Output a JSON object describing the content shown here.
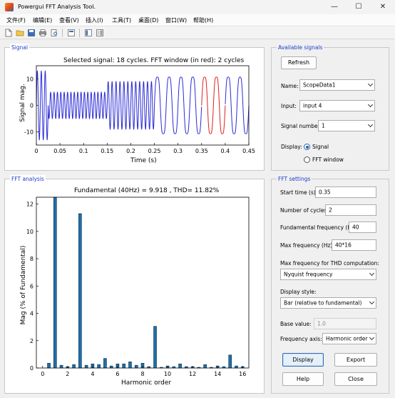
{
  "window": {
    "title": "Powergui FFT Analysis Tool."
  },
  "menu": [
    "文件(F)",
    "编辑(E)",
    "查看(V)",
    "插入(I)",
    "工具(T)",
    "桌面(D)",
    "窗口(W)",
    "帮助(H)"
  ],
  "toolbar_icons": [
    "new-file-icon",
    "open-folder-icon",
    "save-icon",
    "print-icon",
    "print-preview-icon",
    "dock-figure-icon",
    "show-plot-tools-icon",
    "hide-plot-tools-icon"
  ],
  "signal_panel": {
    "title": "Signal",
    "plot_title": "Selected signal: 18 cycles. FFT window (in red): 2 cycles",
    "ylabel": "Signal mag.",
    "xlabel": "Time (s)"
  },
  "available_signals": {
    "title": "Available signals",
    "refresh_label": "Refresh",
    "name_label": "Name:",
    "name_value": "ScopeData1",
    "input_label": "Input:",
    "input_value": "input 4",
    "signal_number_label": "Signal number:",
    "signal_number_value": "1",
    "display_label": "Display:",
    "display_options": [
      "Signal",
      "FFT window"
    ],
    "display_selected": "Signal"
  },
  "fft_panel": {
    "title": "FFT analysis",
    "plot_title": "Fundamental (40Hz) = 9.918 , THD= 11.82%",
    "ylabel": "Mag (% of Fundamental)",
    "xlabel": "Harmonic order"
  },
  "fft_settings": {
    "title": "FFT settings",
    "start_time_label": "Start time (s):",
    "start_time_value": "0.35",
    "num_cycles_label": "Number of cycles:",
    "num_cycles_value": "2",
    "fund_freq_label": "Fundamental frequency (Hz):",
    "fund_freq_value": "40",
    "max_freq_label": "Max frequency (Hz):",
    "max_freq_value": "40*16",
    "max_freq_thd_label": "Max frequency for THD computation:",
    "max_freq_thd_value": "Nyquist frequency",
    "display_style_label": "Display style:",
    "display_style_value": "Bar (relative to fundamental)",
    "base_value_label": "Base value:",
    "base_value_value": "1.0",
    "freq_axis_label": "Frequency axis:",
    "freq_axis_value": "Harmonic order",
    "display_btn": "Display",
    "export_btn": "Export",
    "help_btn": "Help",
    "close_btn": "Close"
  },
  "colors": {
    "accent": "#1f62b3",
    "panel_title": "#1c3ccc",
    "signal_line": "#2b2bd6",
    "fft_window_line": "#e02020",
    "bar_fill": "#1f6fa8"
  },
  "chart_data": [
    {
      "type": "line",
      "title": "Selected signal: 18 cycles. FFT window (in red): 2 cycles",
      "xlabel": "Time (s)",
      "ylabel": "Signal mag.",
      "xlim": [
        0,
        0.45
      ],
      "ylim": [
        -15,
        15
      ],
      "xticks": [
        "0",
        "0.05",
        "0.1",
        "0.15",
        "0.2",
        "0.25",
        "0.3",
        "0.35",
        "0.4",
        "0.45"
      ],
      "yticks": [
        "-10",
        "0",
        "10"
      ],
      "grid": false,
      "segments": [
        {
          "t_start": 0.0,
          "t_end": 0.025,
          "freq_hz": 120,
          "amplitude": 13
        },
        {
          "t_start": 0.025,
          "t_end": 0.15,
          "freq_hz": 140,
          "amplitude": 5
        },
        {
          "t_start": 0.15,
          "t_end": 0.25,
          "freq_hz": 120,
          "amplitude": 9
        },
        {
          "t_start": 0.25,
          "t_end": 0.45,
          "freq_hz": 40,
          "amplitude": 12,
          "harmonic_order": 3,
          "harmonic_amplitude": 1.3
        }
      ],
      "fft_window": {
        "t_start": 0.35,
        "t_end": 0.4
      }
    },
    {
      "type": "bar",
      "title": "Fundamental (40Hz) = 9.918 , THD= 11.82%",
      "xlabel": "Harmonic order",
      "ylabel": "Mag (% of Fundamental)",
      "xlim": [
        -0.5,
        16.5
      ],
      "ylim": [
        0,
        12.5
      ],
      "xticks": [
        "0",
        "2",
        "4",
        "6",
        "8",
        "10",
        "12",
        "14",
        "16"
      ],
      "yticks": [
        "0",
        "2",
        "4",
        "6",
        "8",
        "10",
        "12"
      ],
      "categories": [
        0,
        0.5,
        1,
        1.5,
        2,
        2.5,
        3,
        3.5,
        4,
        4.5,
        5,
        5.5,
        6,
        6.5,
        7,
        7.5,
        8,
        8.5,
        9,
        9.5,
        10,
        10.5,
        11,
        11.5,
        12,
        12.5,
        13,
        13.5,
        14,
        14.5,
        15,
        15.5,
        16
      ],
      "values": [
        0.0,
        0.35,
        100.0,
        0.2,
        0.1,
        0.25,
        11.3,
        0.2,
        0.3,
        0.25,
        0.7,
        0.15,
        0.3,
        0.3,
        0.45,
        0.2,
        0.35,
        0.1,
        3.05,
        0.05,
        0.15,
        0.1,
        0.3,
        0.1,
        0.1,
        0.05,
        0.25,
        0.05,
        0.15,
        0.1,
        0.95,
        0.15,
        0.1
      ]
    }
  ]
}
